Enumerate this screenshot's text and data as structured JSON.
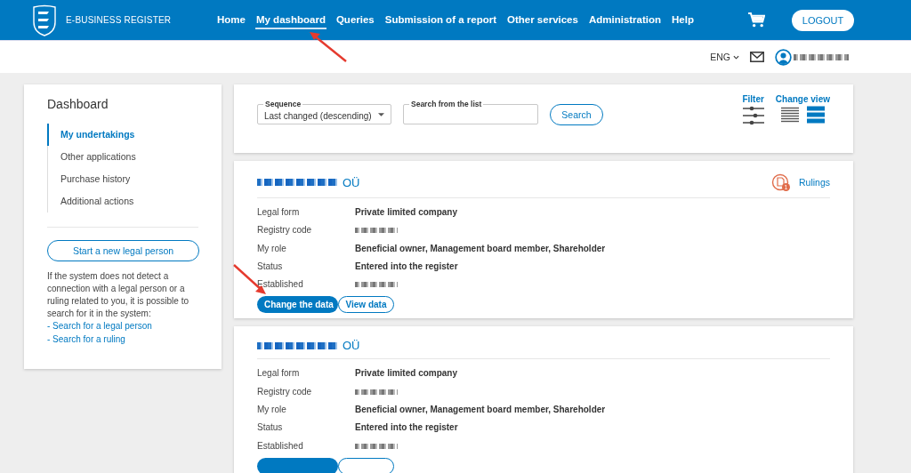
{
  "header": {
    "logo_text": "E-BUSINESS REGISTER",
    "nav": [
      {
        "label": "Home",
        "selected": false
      },
      {
        "label": "My dashboard",
        "selected": true
      },
      {
        "label": "Queries",
        "selected": false
      },
      {
        "label": "Submission of a report",
        "selected": false
      },
      {
        "label": "Other services",
        "selected": false
      },
      {
        "label": "Administration",
        "selected": false
      },
      {
        "label": "Help",
        "selected": false
      }
    ],
    "logout": "LOGOUT"
  },
  "subbar": {
    "language": "ENG"
  },
  "sidebar": {
    "title": "Dashboard",
    "items": [
      {
        "label": "My undertakings",
        "selected": true
      },
      {
        "label": "Other applications",
        "selected": false
      },
      {
        "label": "Purchase history",
        "selected": false
      },
      {
        "label": "Additional actions",
        "selected": false
      }
    ],
    "button": "Start a new legal person",
    "info": "If the system does not detect a connection with a legal person or a ruling related to you, it is possible to search for it in the system:",
    "links": [
      "- Search for a legal person",
      "- Search for a ruling"
    ]
  },
  "toolbar": {
    "sequence": {
      "label": "Sequence",
      "value": "Last changed (descending)"
    },
    "search": {
      "label": "Search from the list"
    },
    "search_button": "Search",
    "filter": "Filter",
    "change_view": "Change view",
    "views": [
      {
        "kind": "lines",
        "selected": false
      },
      {
        "kind": "blocks",
        "selected": true
      }
    ]
  },
  "companies": [
    {
      "name_suffix": "OÜ",
      "rulings": {
        "label": "Rulings",
        "badge": "1"
      },
      "fields": [
        {
          "label": "Legal form",
          "value": "Private limited company"
        },
        {
          "label": "Registry code",
          "redacted": true
        },
        {
          "label": "My role",
          "value": "Beneficial owner, Management board member, Shareholder"
        },
        {
          "label": "Status",
          "value": "Entered into the register"
        },
        {
          "label": "Established",
          "redacted": true
        }
      ],
      "buttons": [
        "Change the data",
        "View data"
      ]
    },
    {
      "name_suffix": "OÜ",
      "fields": [
        {
          "label": "Legal form",
          "value": "Private limited company"
        },
        {
          "label": "Registry code",
          "redacted": true
        },
        {
          "label": "My role",
          "value": "Beneficial owner, Management board member, Shareholder"
        },
        {
          "label": "Status",
          "value": "Entered into the register"
        },
        {
          "label": "Established",
          "redacted": true
        }
      ]
    }
  ]
}
